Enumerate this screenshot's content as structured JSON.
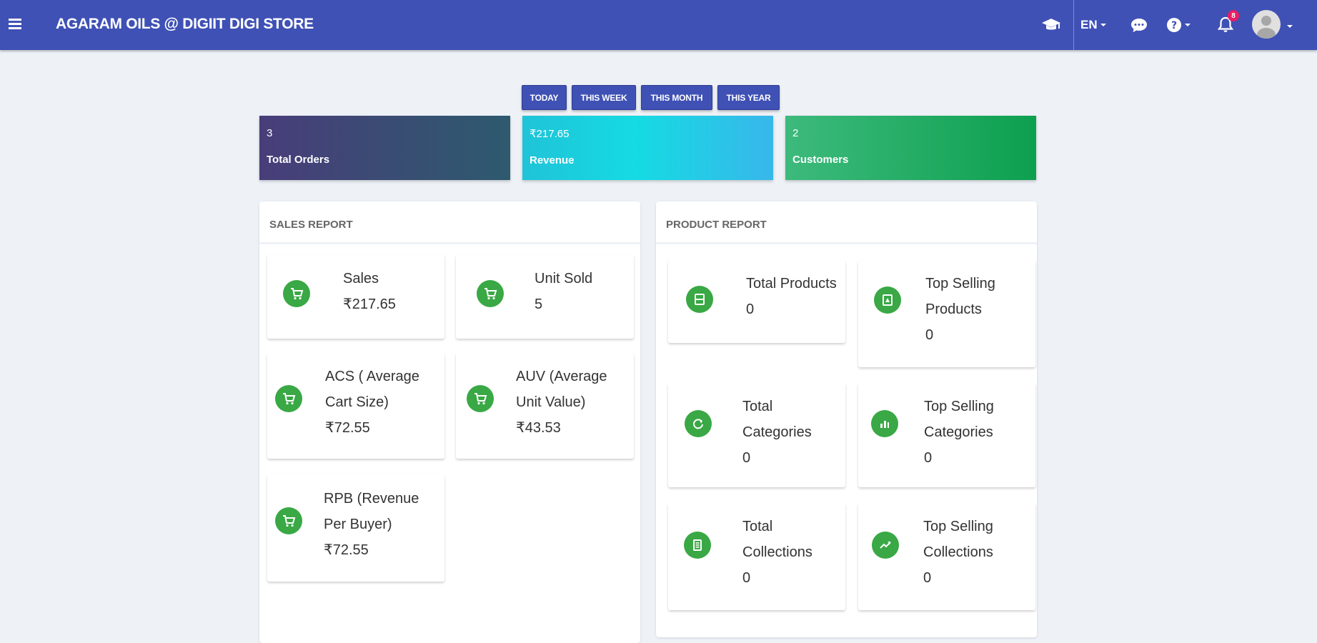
{
  "topbar": {
    "title": "AGARAM OILS @ DIGIIT DIGI STORE",
    "language": "EN",
    "notification_count": "8",
    "icons": [
      "menu-icon",
      "graduation-cap-icon",
      "chat-icon",
      "help-icon",
      "bell-icon",
      "user-avatar-icon"
    ]
  },
  "periods": [
    "TODAY",
    "THIS WEEK",
    "THIS MONTH",
    "THIS YEAR"
  ],
  "stats": {
    "orders": {
      "value": "3",
      "label": "Total Orders",
      "color": "#3f4a78"
    },
    "revenue": {
      "value": "₹217.65",
      "label": "Revenue",
      "color": "#1ed4e2"
    },
    "customers": {
      "value": "2",
      "label": "Customers",
      "color": "#23ad63"
    }
  },
  "sales_report": {
    "title": "SALES REPORT",
    "tiles": [
      {
        "label_lines": [
          "Sales"
        ],
        "value": "₹217.65",
        "icon": "cart-icon"
      },
      {
        "label_lines": [
          "Unit Sold"
        ],
        "value": "5",
        "icon": "cart-icon"
      },
      {
        "label_lines": [
          "ACS ( Average",
          "Cart Size)"
        ],
        "value": "₹72.55",
        "icon": "cart-icon"
      },
      {
        "label_lines": [
          "AUV (Average",
          "Unit Value)"
        ],
        "value": "₹43.53",
        "icon": "cart-icon"
      },
      {
        "label_lines": [
          "RPB (Revenue",
          "Per Buyer)"
        ],
        "value": "₹72.55",
        "icon": "cart-icon"
      }
    ]
  },
  "product_report": {
    "title": "PRODUCT REPORT",
    "tiles": [
      {
        "label_lines": [
          "Total Products"
        ],
        "value": "0",
        "icon": "products-icon"
      },
      {
        "label_lines": [
          "Top Selling",
          "Products"
        ],
        "value": "0",
        "icon": "top-products-icon"
      },
      {
        "label_lines": [
          "Total",
          "Categories"
        ],
        "value": "0",
        "icon": "categories-icon"
      },
      {
        "label_lines": [
          "Top Selling",
          "Categories"
        ],
        "value": "0",
        "icon": "top-categories-icon"
      },
      {
        "label_lines": [
          "Total",
          "Collections"
        ],
        "value": "0",
        "icon": "collections-icon"
      },
      {
        "label_lines": [
          "Top Selling",
          "Collections"
        ],
        "value": "0",
        "icon": "trending-icon"
      }
    ]
  },
  "colors": {
    "primary": "#3f51b5",
    "icon_green": "#39a845",
    "badge": "#e91e63"
  }
}
